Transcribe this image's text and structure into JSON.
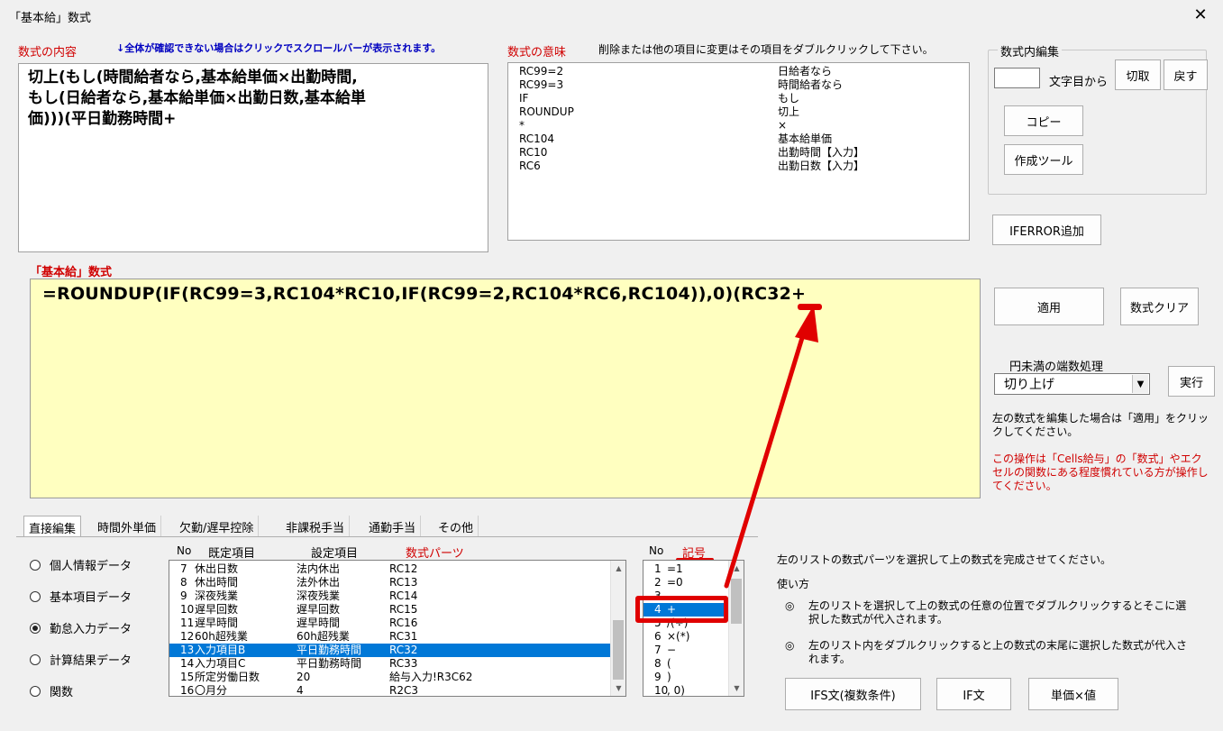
{
  "window": {
    "title": "「基本給」数式",
    "close_glyph": "✕"
  },
  "summary": {
    "label": "数式の内容",
    "note": "↓全体が確認できない場合はクリックでスクロールバーが表示されます。",
    "lines": [
      "切上(もし(時間給者なら,基本給単価×出勤時間,",
      "もし(日給者なら,基本給単価×出勤日数,基本給単",
      "価)))(平日勤務時間+"
    ]
  },
  "meaning": {
    "label": "数式の意味",
    "note": "削除または他の項目に変更はその項目をダブルクリックして下さい。",
    "rows": [
      {
        "code": "RC99=2",
        "text": "日給者なら"
      },
      {
        "code": "RC99=3",
        "text": "時間給者なら"
      },
      {
        "code": "IF",
        "text": "もし"
      },
      {
        "code": "ROUNDUP",
        "text": "切上"
      },
      {
        "code": "*",
        "text": "×"
      },
      {
        "code": "RC104",
        "text": "基本給単価"
      },
      {
        "code": "RC10",
        "text": "出勤時間【入力】"
      },
      {
        "code": "RC6",
        "text": "出勤日数【入力】"
      }
    ]
  },
  "edit_group": {
    "title": "数式内編集",
    "position_suffix": "文字目から",
    "cut_label": "切取",
    "undo_label": "戻す",
    "copy_label": "コピー",
    "tool_label": "作成ツール"
  },
  "iferror_label": "IFERROR追加",
  "formula": {
    "label": "「基本給」数式",
    "value": "=ROUNDUP(IF(RC99=3,RC104*RC10,IF(RC99=2,RC104*RC6,RC104)),0)(RC32+"
  },
  "apply_label": "適用",
  "clear_label": "数式クリア",
  "rounding": {
    "label": "円未満の端数処理",
    "selected": "切り上げ",
    "run_label": "実行"
  },
  "info_text": "左の数式を編集した場合は「適用」をクリックしてください。",
  "warning_text": "この操作は「Cells給与」の「数式」やエクセルの関数にある程度慣れている方が操作してください。",
  "tabs": [
    "直接編集",
    "時間外単価",
    "欠勤/遅早控除",
    "非課税手当",
    "通勤手当",
    "その他"
  ],
  "radios": [
    {
      "label": "個人情報データ",
      "checked": false
    },
    {
      "label": "基本項目データ",
      "checked": false
    },
    {
      "label": "勤怠入力データ",
      "checked": true
    },
    {
      "label": "計算結果データ",
      "checked": false
    },
    {
      "label": "関数",
      "checked": false
    }
  ],
  "parts_list": {
    "headers": {
      "no": "No",
      "default": "既定項目",
      "setting": "設定項目",
      "parts": "数式パーツ"
    },
    "rows": [
      {
        "no": "7",
        "default": "休出日数",
        "setting": "法内休出",
        "parts": "RC12",
        "selected": false
      },
      {
        "no": "8",
        "default": "休出時間",
        "setting": "法外休出",
        "parts": "RC13",
        "selected": false
      },
      {
        "no": "9",
        "default": "深夜残業",
        "setting": "深夜残業",
        "parts": "RC14",
        "selected": false
      },
      {
        "no": "10",
        "default": "遅早回数",
        "setting": "遅早回数",
        "parts": "RC15",
        "selected": false
      },
      {
        "no": "11",
        "default": "遅早時間",
        "setting": "遅早時間",
        "parts": "RC16",
        "selected": false
      },
      {
        "no": "12",
        "default": "60h超残業",
        "setting": "60h超残業",
        "parts": "RC31",
        "selected": false
      },
      {
        "no": "13",
        "default": "入力項目B",
        "setting": "平日勤務時間",
        "parts": "RC32",
        "selected": true
      },
      {
        "no": "14",
        "default": "入力項目C",
        "setting": "平日勤務時間",
        "parts": "RC33",
        "selected": false
      },
      {
        "no": "15",
        "default": "所定労働日数",
        "setting": "20",
        "parts": "給与入力!R3C62",
        "selected": false
      },
      {
        "no": "16",
        "default": "〇月分",
        "setting": "4",
        "parts": "R2C3",
        "selected": false
      }
    ]
  },
  "symbols": {
    "headers": {
      "no": "No",
      "symbol": "記号"
    },
    "rows": [
      {
        "no": "1",
        "sym": "=1",
        "selected": false
      },
      {
        "no": "2",
        "sym": "=0",
        "selected": false
      },
      {
        "no": "3",
        "sym": "-",
        "selected": false
      },
      {
        "no": "4",
        "sym": "+",
        "selected": true
      },
      {
        "no": "5",
        "sym": "/(÷)",
        "selected": false
      },
      {
        "no": "6",
        "sym": "×(*)",
        "selected": false
      },
      {
        "no": "7",
        "sym": "−",
        "selected": false
      },
      {
        "no": "8",
        "sym": "(",
        "selected": false
      },
      {
        "no": "9",
        "sym": ")",
        "selected": false
      },
      {
        "no": "10",
        "sym": ", 0)",
        "selected": false
      }
    ]
  },
  "help": {
    "intro": "左のリストの数式パーツを選択して上の数式を完成させてください。",
    "usage_title": "使い方",
    "bullet_glyph": "◎",
    "item1": "左のリストを選択して上の数式の任意の位置でダブルクリックするとそこに選択した数式が代入されます。",
    "item2": "左のリスト内をダブルクリックすると上の数式の末尾に選択した数式が代入されます。",
    "ifs_label": "IFS文(複数条件)",
    "if_label": "IF文",
    "unit_label": "単価×値"
  },
  "colors": {
    "formula_bg": "#ffffc0",
    "selection": "#0078d7",
    "annotation_red": "#e00000",
    "label_red": "#d00000"
  }
}
